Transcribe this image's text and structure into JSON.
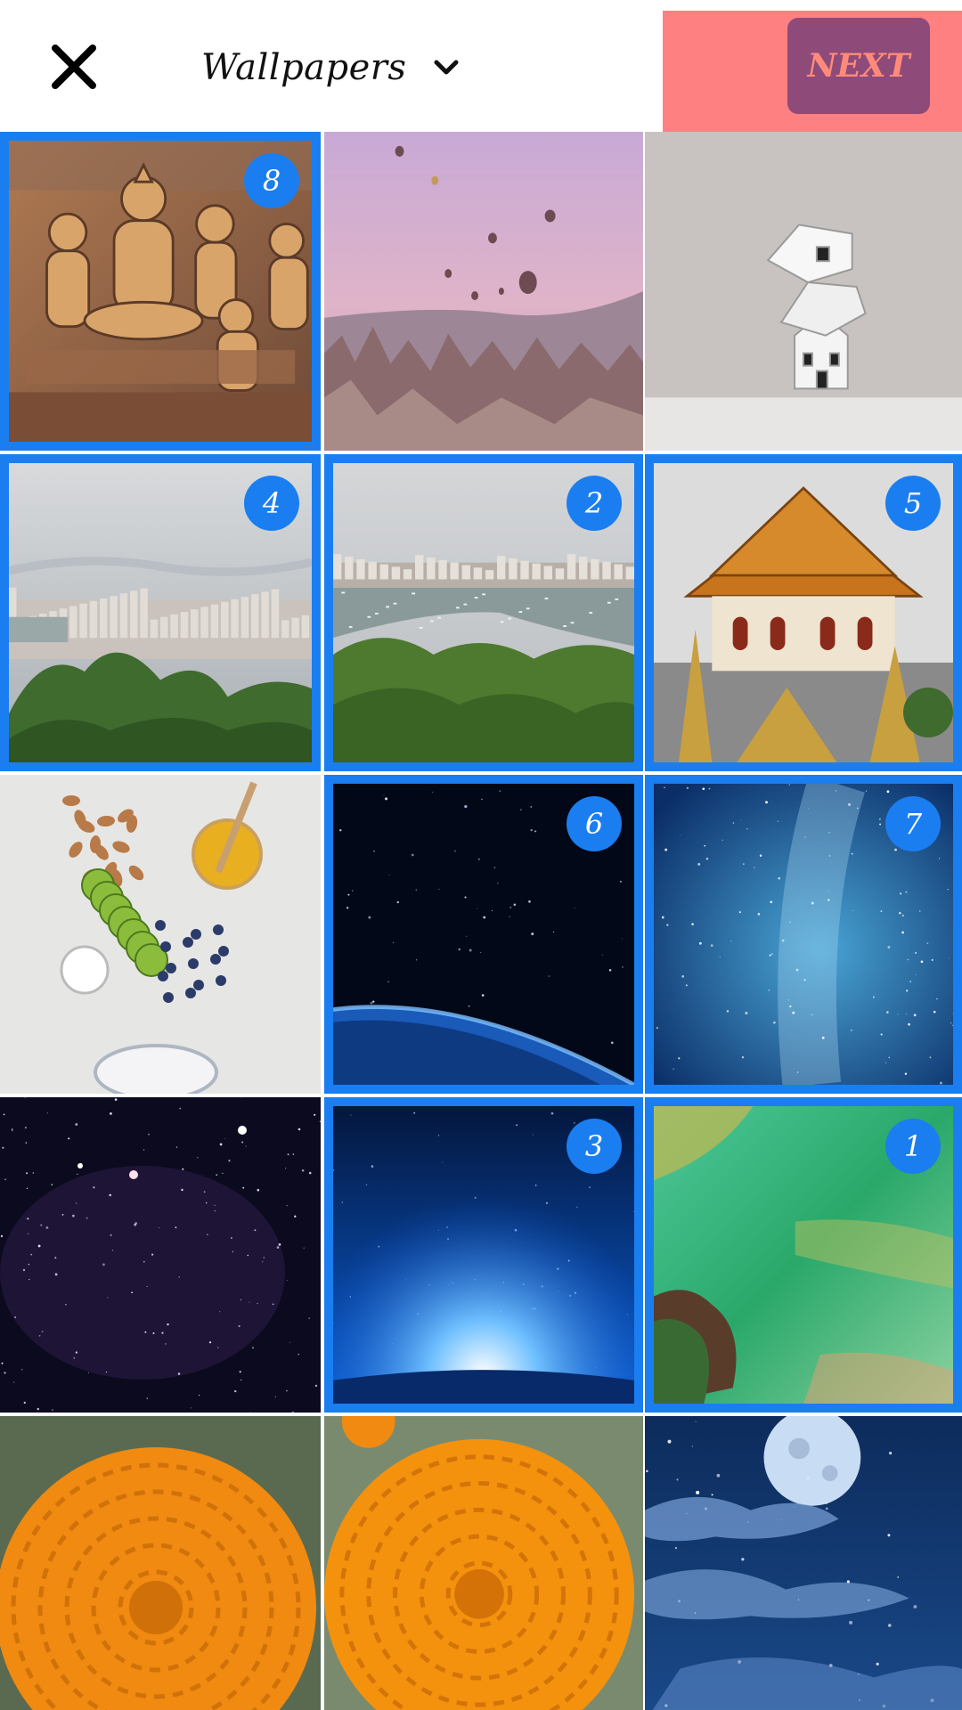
{
  "header": {
    "close_icon": "close-icon",
    "album_title": "Wallpapers",
    "dropdown_icon": "chevron-down-icon",
    "next_label": "NEXT"
  },
  "colors": {
    "selection": "#1a7ef0",
    "badge": "#1a7ef0",
    "next_highlight": "#ff8080",
    "next_button_bg": "#8e4a79",
    "next_label": "#ff8a7a"
  },
  "photos": [
    {
      "subject": "golden buddha wall relief",
      "selected": true,
      "order": "8"
    },
    {
      "subject": "hot air balloons over cappadocia",
      "selected": false,
      "order": ""
    },
    {
      "subject": "stacked paper houses",
      "selected": false,
      "order": ""
    },
    {
      "subject": "pattaya city view with trees",
      "selected": true,
      "order": "4"
    },
    {
      "subject": "pattaya bay with boats",
      "selected": true,
      "order": "2"
    },
    {
      "subject": "thai temple roof",
      "selected": true,
      "order": "5"
    },
    {
      "subject": "almonds kiwi honey blueberries",
      "selected": false,
      "order": ""
    },
    {
      "subject": "earth horizon in space",
      "selected": true,
      "order": "6"
    },
    {
      "subject": "blue milky way",
      "selected": true,
      "order": "7"
    },
    {
      "subject": "purple starfield",
      "selected": false,
      "order": ""
    },
    {
      "subject": "blue light rising over planet",
      "selected": true,
      "order": "3"
    },
    {
      "subject": "green abstract watercolor",
      "selected": true,
      "order": "1"
    },
    {
      "subject": "orange marigold flower",
      "selected": false,
      "order": ""
    },
    {
      "subject": "orange marigold flower close-up",
      "selected": false,
      "order": ""
    },
    {
      "subject": "full moon night clouds",
      "selected": false,
      "order": ""
    }
  ]
}
